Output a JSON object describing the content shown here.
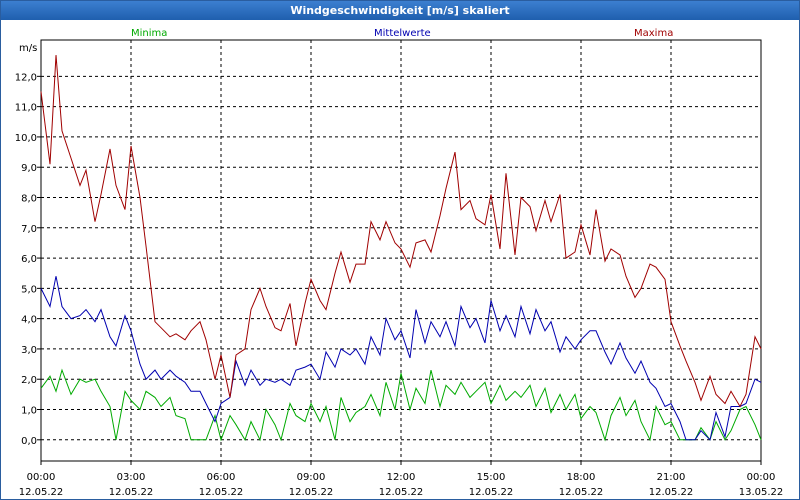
{
  "window": {
    "title": "Windgeschwindigkeit [m/s] skaliert"
  },
  "colors": {
    "minima": "#00aa00",
    "mittel": "#0000b0",
    "maxima": "#a00000",
    "grid": "#000000",
    "titlebar": "#2f6fc0"
  },
  "chart_data": {
    "type": "line",
    "title": "Windgeschwindigkeit [m/s] skaliert",
    "ylabel": "m/s",
    "xlabel": "",
    "ylim": [
      -0.7,
      13.2
    ],
    "xlim_hours": [
      0,
      24
    ],
    "grid": true,
    "legend_position": "top",
    "y_ticks": [
      "0,0",
      "1,0",
      "2,0",
      "3,0",
      "4,0",
      "5,0",
      "6,0",
      "7,0",
      "8,0",
      "9,0",
      "10,0",
      "11,0",
      "12,0"
    ],
    "x_ticks": [
      {
        "time": "00:00",
        "date": "12.05.22"
      },
      {
        "time": "03:00",
        "date": "12.05.22"
      },
      {
        "time": "06:00",
        "date": "12.05.22"
      },
      {
        "time": "09:00",
        "date": "12.05.22"
      },
      {
        "time": "12:00",
        "date": "12.05.22"
      },
      {
        "time": "15:00",
        "date": "12.05.22"
      },
      {
        "time": "18:00",
        "date": "12.05.22"
      },
      {
        "time": "21:00",
        "date": "12.05.22"
      },
      {
        "time": "00:00",
        "date": "13.05.22"
      }
    ],
    "x_hours": [
      0.0,
      0.3,
      0.5,
      0.7,
      1.0,
      1.3,
      1.5,
      1.8,
      2.0,
      2.3,
      2.5,
      2.8,
      3.0,
      3.3,
      3.5,
      3.8,
      4.0,
      4.3,
      4.5,
      4.8,
      5.0,
      5.3,
      5.5,
      5.8,
      6.0,
      6.3,
      6.5,
      6.8,
      7.0,
      7.3,
      7.5,
      7.8,
      8.0,
      8.3,
      8.5,
      8.8,
      9.0,
      9.3,
      9.5,
      9.8,
      10.0,
      10.3,
      10.5,
      10.8,
      11.0,
      11.3,
      11.5,
      11.8,
      12.0,
      12.3,
      12.5,
      12.8,
      13.0,
      13.3,
      13.5,
      13.8,
      14.0,
      14.3,
      14.5,
      14.8,
      15.0,
      15.3,
      15.5,
      15.8,
      16.0,
      16.3,
      16.5,
      16.8,
      17.0,
      17.3,
      17.5,
      17.8,
      18.0,
      18.3,
      18.5,
      18.8,
      19.0,
      19.3,
      19.5,
      19.8,
      20.0,
      20.3,
      20.5,
      20.8,
      21.0,
      21.3,
      21.5,
      21.8,
      22.0,
      22.3,
      22.5,
      22.8,
      23.0,
      23.3,
      23.5,
      23.8,
      24.0
    ],
    "series": [
      {
        "name": "Minima",
        "values": [
          1.7,
          2.1,
          1.6,
          2.3,
          1.5,
          2.0,
          1.9,
          2.0,
          1.6,
          1.1,
          0.0,
          1.6,
          1.3,
          1.0,
          1.6,
          1.4,
          1.1,
          1.4,
          0.8,
          0.7,
          0.0,
          0.0,
          0.0,
          0.8,
          0.0,
          0.8,
          0.5,
          0.0,
          0.6,
          0.0,
          1.0,
          0.5,
          0.0,
          1.2,
          0.8,
          0.6,
          1.2,
          0.6,
          1.1,
          0.0,
          1.4,
          0.6,
          0.9,
          1.1,
          1.5,
          0.8,
          1.9,
          1.0,
          2.2,
          1.0,
          1.7,
          1.2,
          2.3,
          1.1,
          1.8,
          1.5,
          1.9,
          1.4,
          1.6,
          1.9,
          1.2,
          1.8,
          1.3,
          1.6,
          1.4,
          1.8,
          1.1,
          1.7,
          0.9,
          1.5,
          1.0,
          1.5,
          0.7,
          1.1,
          0.9,
          0.0,
          0.8,
          1.4,
          0.8,
          1.3,
          0.6,
          0.0,
          1.1,
          0.5,
          0.6,
          0.0,
          0.0,
          0.0,
          0.4,
          0.0,
          0.6,
          0.0,
          0.3,
          1.0,
          1.1,
          0.5,
          0.0
        ]
      },
      {
        "name": "Mittelwerte",
        "values": [
          5.0,
          4.4,
          5.4,
          4.4,
          4.0,
          4.1,
          4.3,
          3.9,
          4.3,
          3.4,
          3.1,
          4.1,
          3.6,
          2.5,
          2.0,
          2.3,
          2.0,
          2.3,
          2.1,
          1.9,
          1.6,
          1.6,
          1.2,
          0.6,
          1.2,
          1.4,
          2.6,
          1.8,
          2.3,
          1.8,
          2.0,
          1.9,
          2.0,
          1.8,
          2.3,
          2.4,
          2.5,
          2.0,
          2.9,
          2.4,
          3.0,
          2.8,
          3.0,
          2.5,
          3.4,
          2.8,
          4.0,
          3.3,
          3.6,
          2.7,
          4.3,
          3.2,
          3.9,
          3.4,
          3.9,
          3.1,
          4.4,
          3.7,
          4.0,
          3.2,
          4.6,
          3.6,
          4.1,
          3.4,
          4.4,
          3.5,
          4.3,
          3.6,
          3.9,
          2.9,
          3.4,
          3.0,
          3.3,
          3.6,
          3.6,
          2.9,
          2.5,
          3.2,
          2.7,
          2.2,
          2.6,
          1.9,
          1.7,
          1.1,
          1.2,
          0.6,
          0.0,
          0.0,
          0.3,
          0.0,
          0.9,
          0.1,
          1.1,
          1.1,
          1.2,
          2.0,
          1.9
        ]
      },
      {
        "name": "Maxima",
        "values": [
          11.5,
          9.1,
          12.7,
          10.2,
          9.3,
          8.4,
          8.9,
          7.2,
          8.1,
          9.6,
          8.4,
          7.6,
          9.7,
          8.0,
          6.4,
          3.9,
          3.7,
          3.4,
          3.5,
          3.3,
          3.6,
          3.9,
          3.3,
          2.0,
          2.8,
          1.4,
          2.8,
          3.0,
          4.3,
          5.0,
          4.4,
          3.7,
          3.6,
          4.5,
          3.1,
          4.5,
          5.3,
          4.6,
          4.3,
          5.5,
          6.2,
          5.2,
          5.8,
          5.8,
          7.2,
          6.6,
          7.2,
          6.5,
          6.3,
          5.7,
          6.5,
          6.6,
          6.2,
          7.4,
          8.3,
          9.5,
          7.6,
          7.9,
          7.3,
          7.1,
          8.1,
          6.3,
          8.8,
          6.1,
          8.0,
          7.7,
          6.9,
          7.9,
          7.2,
          8.1,
          6.0,
          6.2,
          7.1,
          6.1,
          7.6,
          5.9,
          6.3,
          6.1,
          5.4,
          4.7,
          5.0,
          5.8,
          5.7,
          5.3,
          3.9,
          3.1,
          2.6,
          1.9,
          1.3,
          2.1,
          1.5,
          1.2,
          1.6,
          1.1,
          1.5,
          3.4,
          3.0
        ]
      }
    ]
  }
}
